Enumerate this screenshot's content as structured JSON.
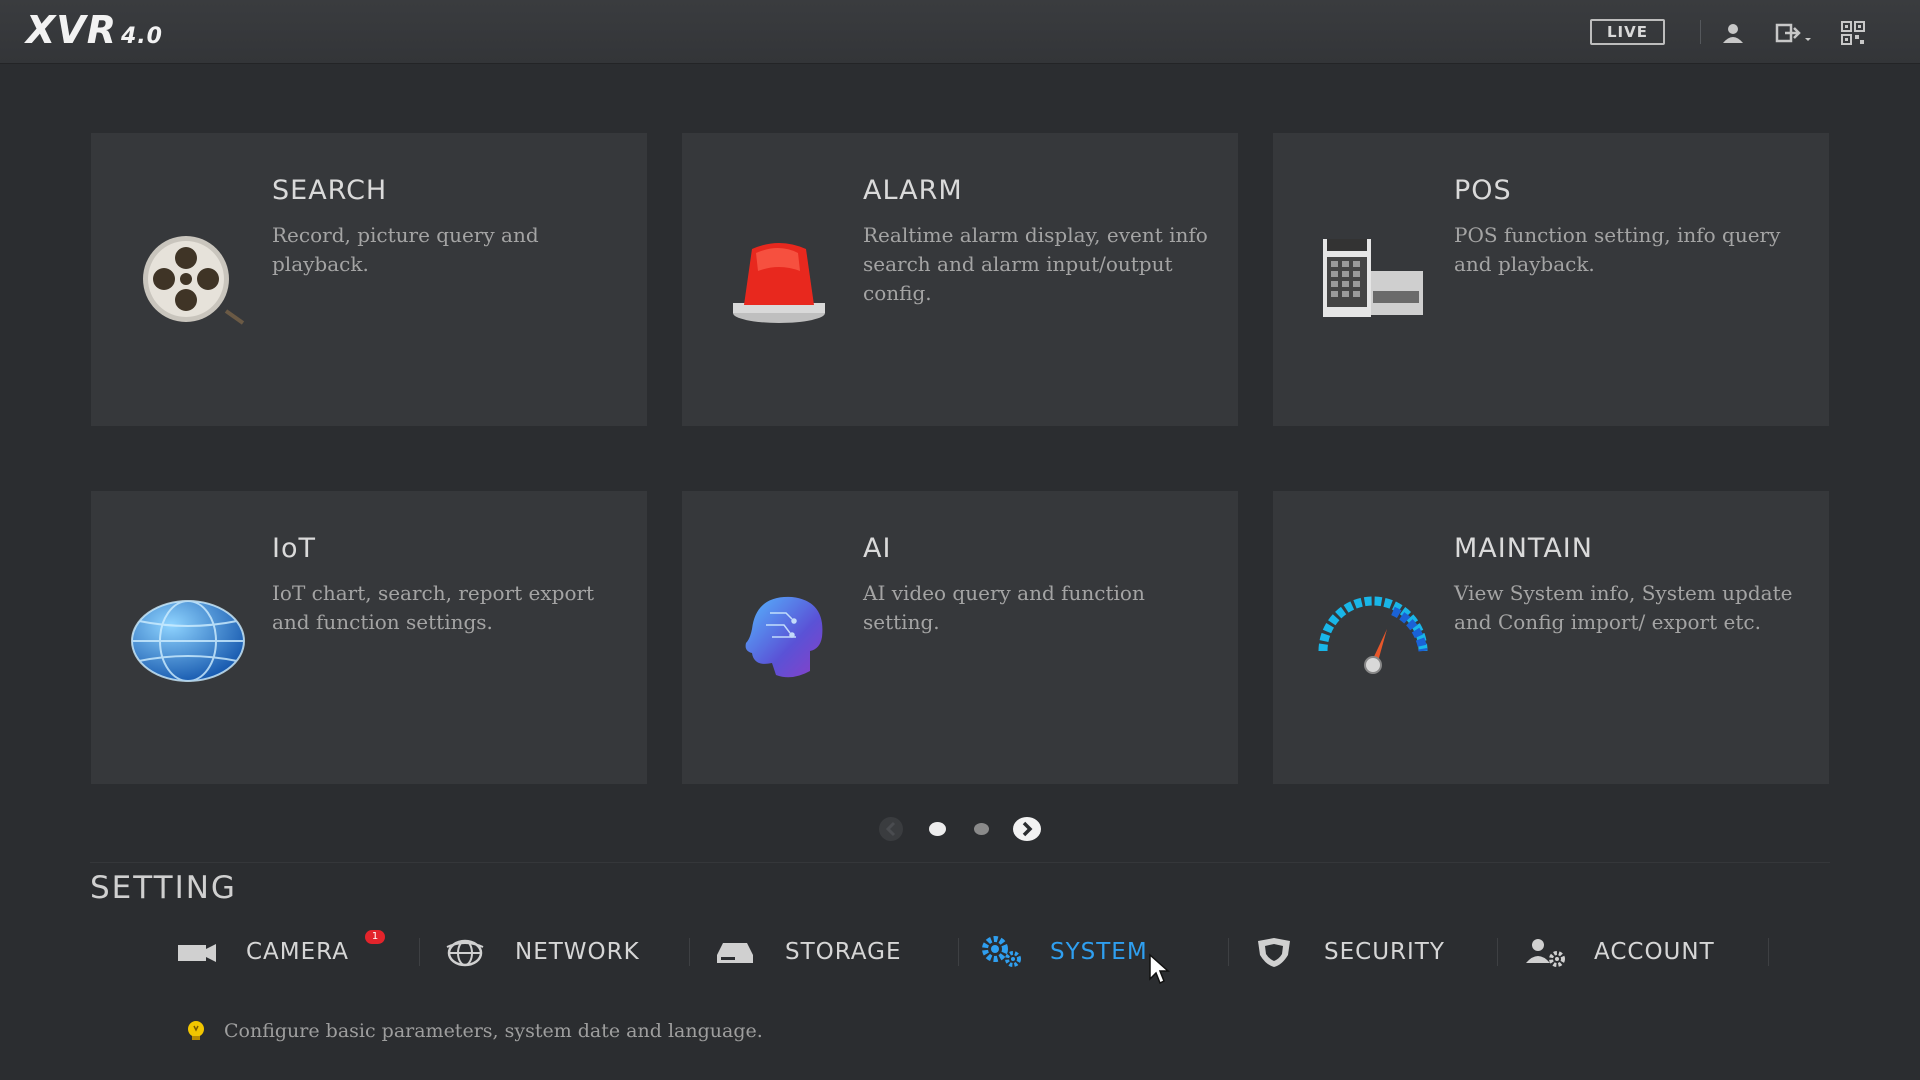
{
  "header": {
    "logo_text": "XVR",
    "logo_version": "4.0",
    "live_label": "LIVE",
    "icons": [
      "user-icon",
      "logout-icon",
      "qr-code-icon"
    ]
  },
  "tiles": [
    {
      "title": "SEARCH",
      "description": "Record, picture query and playback.",
      "icon": "film-reel-icon"
    },
    {
      "title": "ALARM",
      "description": "Realtime alarm display, event info search and alarm input/output config.",
      "icon": "alarm-light-icon"
    },
    {
      "title": "POS",
      "description": "POS function setting, info query and playback.",
      "icon": "cash-register-icon"
    },
    {
      "title": "IoT",
      "description": "IoT chart, search, report export and function settings.",
      "icon": "globe-icon"
    },
    {
      "title": "AI",
      "description": "AI video query and function setting.",
      "icon": "ai-brain-icon"
    },
    {
      "title": "MAINTAIN",
      "description": "View System info, System update and Config import/ export etc.",
      "icon": "gauge-icon"
    }
  ],
  "pager": {
    "current_page": 1,
    "total_pages": 2
  },
  "setting": {
    "title": "SETTING",
    "items": [
      {
        "label": "CAMERA",
        "icon": "camera-icon",
        "badge": "1"
      },
      {
        "label": "NETWORK",
        "icon": "network-globe-icon"
      },
      {
        "label": "STORAGE",
        "icon": "hard-drive-icon"
      },
      {
        "label": "SYSTEM",
        "icon": "gears-icon",
        "active": true
      },
      {
        "label": "SECURITY",
        "icon": "shield-icon"
      },
      {
        "label": "ACCOUNT",
        "icon": "account-gear-icon"
      }
    ],
    "hint": "Configure basic parameters, system date and language.",
    "hint_icon": "lightbulb-icon"
  },
  "colors": {
    "accent": "#2f9ff0",
    "background": "#2b2d30",
    "tile": "#36383b",
    "badge": "#e3242b"
  }
}
